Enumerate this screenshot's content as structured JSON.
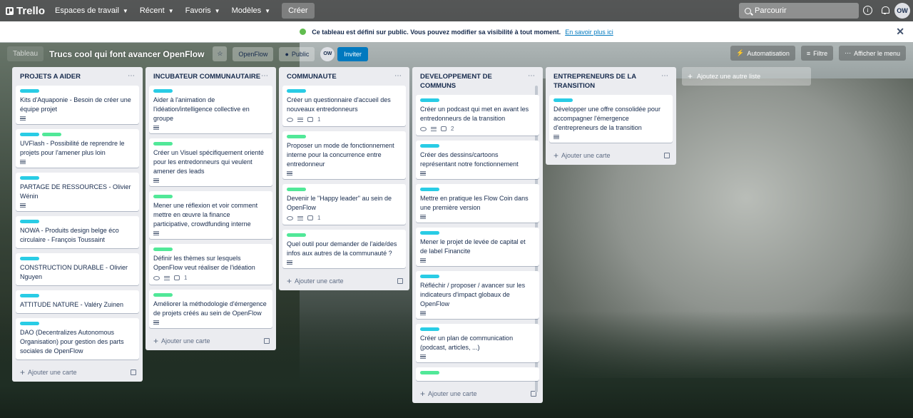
{
  "topbar": {
    "app_name": "Trello",
    "nav": [
      "Espaces de travail",
      "Récent",
      "Favoris",
      "Modèles"
    ],
    "create": "Créer",
    "search_placeholder": "Parcourir",
    "avatar": "OW"
  },
  "banner": {
    "text": "Ce tableau est défini sur public. Vous pouvez modifier sa visibilité à tout moment.",
    "link": "En savoir plus ici"
  },
  "board": {
    "view": "Tableau",
    "title": "Trucs cool qui font avancer OpenFlow",
    "workspace": "OpenFlow",
    "visibility": "Public",
    "member": "OW",
    "invite": "Inviter",
    "automation": "Automatisation",
    "filter": "Filtre",
    "show_menu": "Afficher le menu"
  },
  "add_card_label": "Ajouter une carte",
  "add_list_label": "Ajoutez une autre liste",
  "colors": {
    "cyan": "#29cce5",
    "green": "#51e898"
  },
  "lists": [
    {
      "title": "PROJETS A AIDER",
      "cards": [
        {
          "title": "Kits d'Aquaponie - Besoin de créer une équipe projet",
          "labels": [
            "cyan"
          ],
          "desc": true
        },
        {
          "title": "UVFlash - Possibilité de reprendre le projets pour l'amener plus loin",
          "labels": [
            "cyan",
            "green"
          ],
          "desc": true
        },
        {
          "title": "PARTAGE DE RESSOURCES - Olivier Wénin",
          "labels": [
            "cyan"
          ],
          "desc": true
        },
        {
          "title": "NOWA - Produits design belge éco circulaire - François Toussaint",
          "labels": [
            "cyan"
          ],
          "desc": false
        },
        {
          "title": "CONSTRUCTION DURABLE - Olivier Nguyen",
          "labels": [
            "cyan"
          ],
          "desc": false
        },
        {
          "title": "ATTITUDE NATURE - Valéry Zuinen",
          "labels": [
            "cyan"
          ],
          "desc": false
        },
        {
          "title": "DAO (Decentralizes Autonomous Organisation) pour gestion des parts sociales de OpenFlow",
          "labels": [
            "cyan"
          ],
          "desc": false
        }
      ]
    },
    {
      "title": "INCUBATEUR COMMUNAUTAIRE",
      "cards": [
        {
          "title": "Aider à l'animation de l'idéation/intelligence collective en groupe",
          "labels": [
            "cyan"
          ],
          "desc": true
        },
        {
          "title": "Créer un Visuel spécifiquement orienté pour les entredonneurs qui veulent amener des leads",
          "labels": [
            "green"
          ],
          "desc": true
        },
        {
          "title": "Mener une réflexion et voir comment mettre en œuvre la finance participative, crowdfunding interne",
          "labels": [
            "green"
          ],
          "desc": true
        },
        {
          "title": "Définir les thèmes sur lesquels OpenFlow veut réaliser de l'idéation",
          "labels": [
            "green"
          ],
          "desc": true,
          "watch": true,
          "comments": "1"
        },
        {
          "title": "Améliorer la méthodologie d'émergence de projets créés au sein de OpenFlow",
          "labels": [
            "green"
          ],
          "desc": true
        }
      ]
    },
    {
      "title": "COMMUNAUTE",
      "cards": [
        {
          "title": "Créer un questionnaire d'accueil des nouveaux entredonneurs",
          "labels": [
            "cyan"
          ],
          "desc": true,
          "watch": true,
          "comments": "1"
        },
        {
          "title": "Proposer un mode de fonctionnement interne pour la concurrence entre entredonneur",
          "labels": [
            "green"
          ],
          "desc": true
        },
        {
          "title": "Devenir le \"Happy leader\" au sein de OpenFlow",
          "labels": [
            "green"
          ],
          "desc": true,
          "watch": true,
          "comments": "1"
        },
        {
          "title": "Quel outil pour demander de l'aide/des infos aux autres de la communauté ?",
          "labels": [
            "green"
          ],
          "desc": true
        }
      ]
    },
    {
      "title": "DEVELOPPEMENT DE COMMUNS",
      "cards": [
        {
          "title": "Créer un podcast qui met en avant les entredonneurs de la transition",
          "labels": [
            "cyan"
          ],
          "desc": true,
          "watch": true,
          "comments": "2"
        },
        {
          "title": "Créer des dessins/cartoons représentant notre fonctionnement",
          "labels": [
            "cyan"
          ],
          "desc": true
        },
        {
          "title": "Mettre en pratique les Flow Coin dans une première version",
          "labels": [
            "cyan"
          ],
          "desc": true
        },
        {
          "title": "Mener le projet de levée de capital et de label Financite",
          "labels": [
            "cyan"
          ],
          "desc": true
        },
        {
          "title": "Réfléchir / proposer / avancer sur les indicateurs d'impact globaux de OpenFlow",
          "labels": [
            "cyan"
          ],
          "desc": true
        },
        {
          "title": "Créer un plan de communication (podcast, articles, ...)",
          "labels": [
            "cyan"
          ],
          "desc": true
        },
        {
          "title": "",
          "labels": [
            "green"
          ],
          "desc": false
        }
      ]
    },
    {
      "title": "ENTREPRENEURS DE LA TRANSITION",
      "cards": [
        {
          "title": "Développer une offre consolidée pour accompagner l'émergence d'entrepreneurs de la transition",
          "labels": [
            "cyan"
          ],
          "desc": true
        }
      ]
    }
  ]
}
